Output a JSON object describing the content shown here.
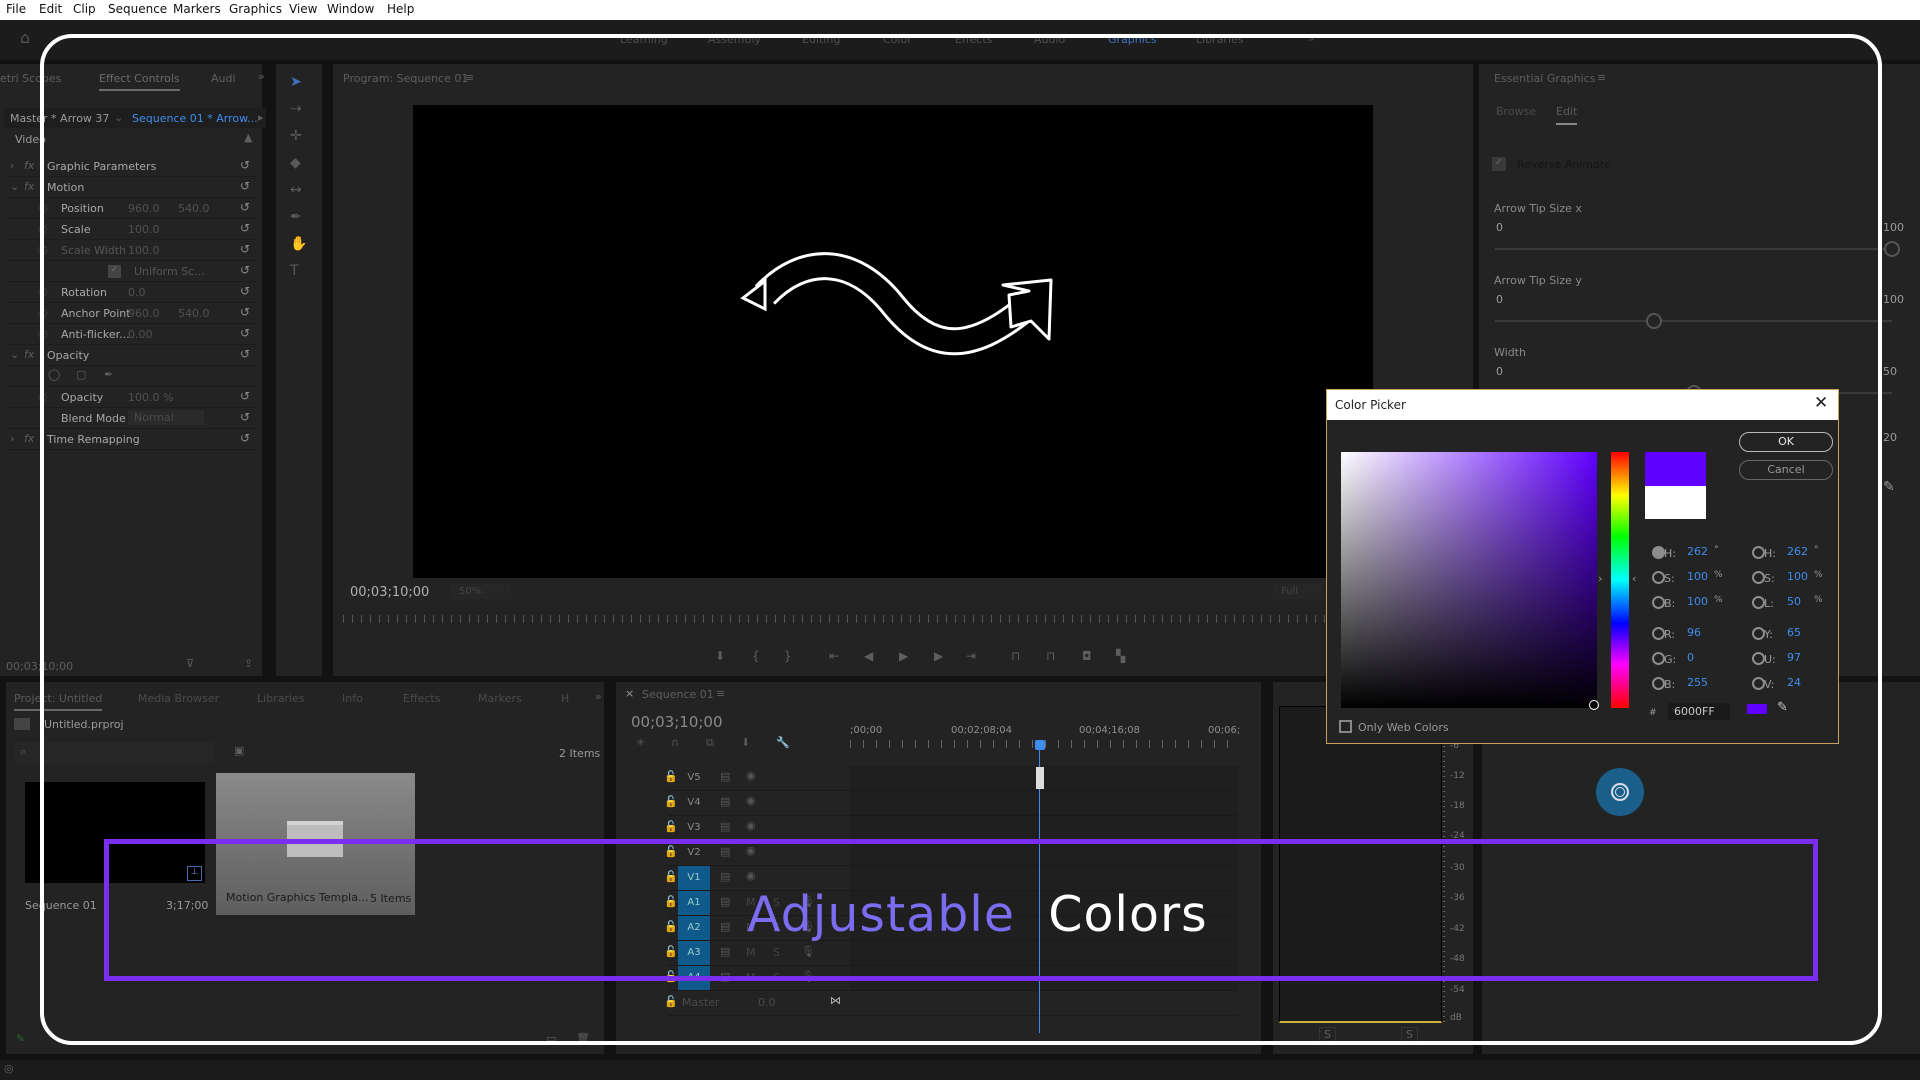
{
  "menu": [
    "File",
    "Edit",
    "Clip",
    "Sequence",
    "Markers",
    "Graphics",
    "View",
    "Window",
    "Help"
  ],
  "workspaces": {
    "tabs": [
      "Learning",
      "Assembly",
      "Editing",
      "Color",
      "Effects",
      "Audio",
      "Graphics",
      "Libraries"
    ],
    "active": "Graphics",
    "more": "»"
  },
  "effect_controls": {
    "tabs": [
      "etri Scopes",
      "Effect Controls",
      "Audi"
    ],
    "master": "Master * Arrow 37",
    "sequence": "Sequence 01 * Arrow...",
    "section": "Video",
    "rows": [
      {
        "label": "Graphic Parameters",
        "kind": "header"
      },
      {
        "label": "Motion",
        "kind": "header"
      },
      {
        "label": "Position",
        "v1": "960.0",
        "v2": "540.0",
        "kind": "prop"
      },
      {
        "label": "Scale",
        "v1": "100.0",
        "kind": "prop"
      },
      {
        "label": "Scale Width",
        "v1": "100.0",
        "kind": "prop-dim"
      },
      {
        "label": "Uniform Sc...",
        "kind": "check"
      },
      {
        "label": "Rotation",
        "v1": "0.0",
        "kind": "prop"
      },
      {
        "label": "Anchor Point",
        "v1": "960.0",
        "v2": "540.0",
        "kind": "prop"
      },
      {
        "label": "Anti-flicker...",
        "v1": "0.00",
        "kind": "prop"
      },
      {
        "label": "Opacity",
        "kind": "header"
      },
      {
        "label": "",
        "kind": "masks"
      },
      {
        "label": "Opacity",
        "v1": "100.0 %",
        "kind": "prop"
      },
      {
        "label": "Blend Mode",
        "v1": "Normal",
        "kind": "select"
      },
      {
        "label": "Time Remapping",
        "kind": "header"
      }
    ],
    "timecode": "00;03;10;00"
  },
  "program": {
    "title": "Program: Sequence 01",
    "timecode": "00;03;10;00",
    "zoom": "50%",
    "resolution": "Full"
  },
  "essential_graphics": {
    "title": "Essential Graphics",
    "tabs": [
      "Browse",
      "Edit"
    ],
    "active_tab": "Edit",
    "reverse_animate": "Reverse Animate",
    "params": [
      {
        "label": "Arrow Tip Size x",
        "min": "0",
        "max": "100",
        "value_fraction": 1.0
      },
      {
        "label": "Arrow Tip Size y",
        "min": "0",
        "max": "100",
        "value_fraction": 0.4
      },
      {
        "label": "Width",
        "min": "0",
        "max": "50",
        "value_fraction": 0.5
      }
    ],
    "extra_max": "20"
  },
  "color_picker": {
    "title": "Color Picker",
    "ok": "OK",
    "cancel": "Cancel",
    "new_color": "#6000FF",
    "old_color": "#FFFFFF",
    "left": [
      {
        "k": "H:",
        "v": "262",
        "u": "°",
        "sel": true
      },
      {
        "k": "S:",
        "v": "100",
        "u": "%"
      },
      {
        "k": "B:",
        "v": "100",
        "u": "%"
      },
      {
        "k": "R:",
        "v": "96"
      },
      {
        "k": "G:",
        "v": "0"
      },
      {
        "k": "B:",
        "v": "255"
      }
    ],
    "right": [
      {
        "k": "H:",
        "v": "262",
        "u": "°"
      },
      {
        "k": "S:",
        "v": "100",
        "u": "%"
      },
      {
        "k": "L:",
        "v": "50",
        "u": "%"
      },
      {
        "k": "Y:",
        "v": "65"
      },
      {
        "k": "U:",
        "v": "97"
      },
      {
        "k": "V:",
        "v": "24"
      }
    ],
    "hash": "#",
    "hex": "6000FF",
    "only_web": "Only Web Colors"
  },
  "project": {
    "tabs": [
      "Project: Untitled",
      "Media Browser",
      "Libraries",
      "Info",
      "Effects",
      "Markers",
      "H"
    ],
    "file": "Untitled.prproj",
    "count": "2 Items",
    "items": [
      {
        "name": "Sequence 01",
        "meta": "3;17;00"
      },
      {
        "name": "Motion Graphics Templa...",
        "meta": "5 Items"
      }
    ]
  },
  "timeline": {
    "tab": "Sequence 01",
    "close": "×",
    "timecode": "00;03;10;00",
    "ruler": [
      ";00;00",
      "00;02;08;04",
      "00;04;16;08",
      "00;06;"
    ],
    "tracks": [
      {
        "n": "V5",
        "t": "v"
      },
      {
        "n": "V4",
        "t": "v"
      },
      {
        "n": "V3",
        "t": "v"
      },
      {
        "n": "V2",
        "t": "v"
      },
      {
        "n": "V1",
        "t": "v",
        "on": true
      },
      {
        "n": "A1",
        "t": "a",
        "on": true
      },
      {
        "n": "A2",
        "t": "a",
        "on": true
      },
      {
        "n": "A3",
        "t": "a",
        "on": true
      },
      {
        "n": "A4",
        "t": "a",
        "on": true
      }
    ],
    "master": "Master",
    "master_val": "0.0",
    "mute": "M",
    "solo": "S"
  },
  "audio_meter": {
    "scale": [
      "-6",
      "-12",
      "-18",
      "-24",
      "-30",
      "-36",
      "-42",
      "-48",
      "-54",
      "dB"
    ],
    "solo": [
      "S",
      "S"
    ]
  },
  "overlay": {
    "word1": "Adjustable",
    "word2": "Colors",
    "accent": "#7a2ff0",
    "word1_color": "#7b6cf0"
  }
}
